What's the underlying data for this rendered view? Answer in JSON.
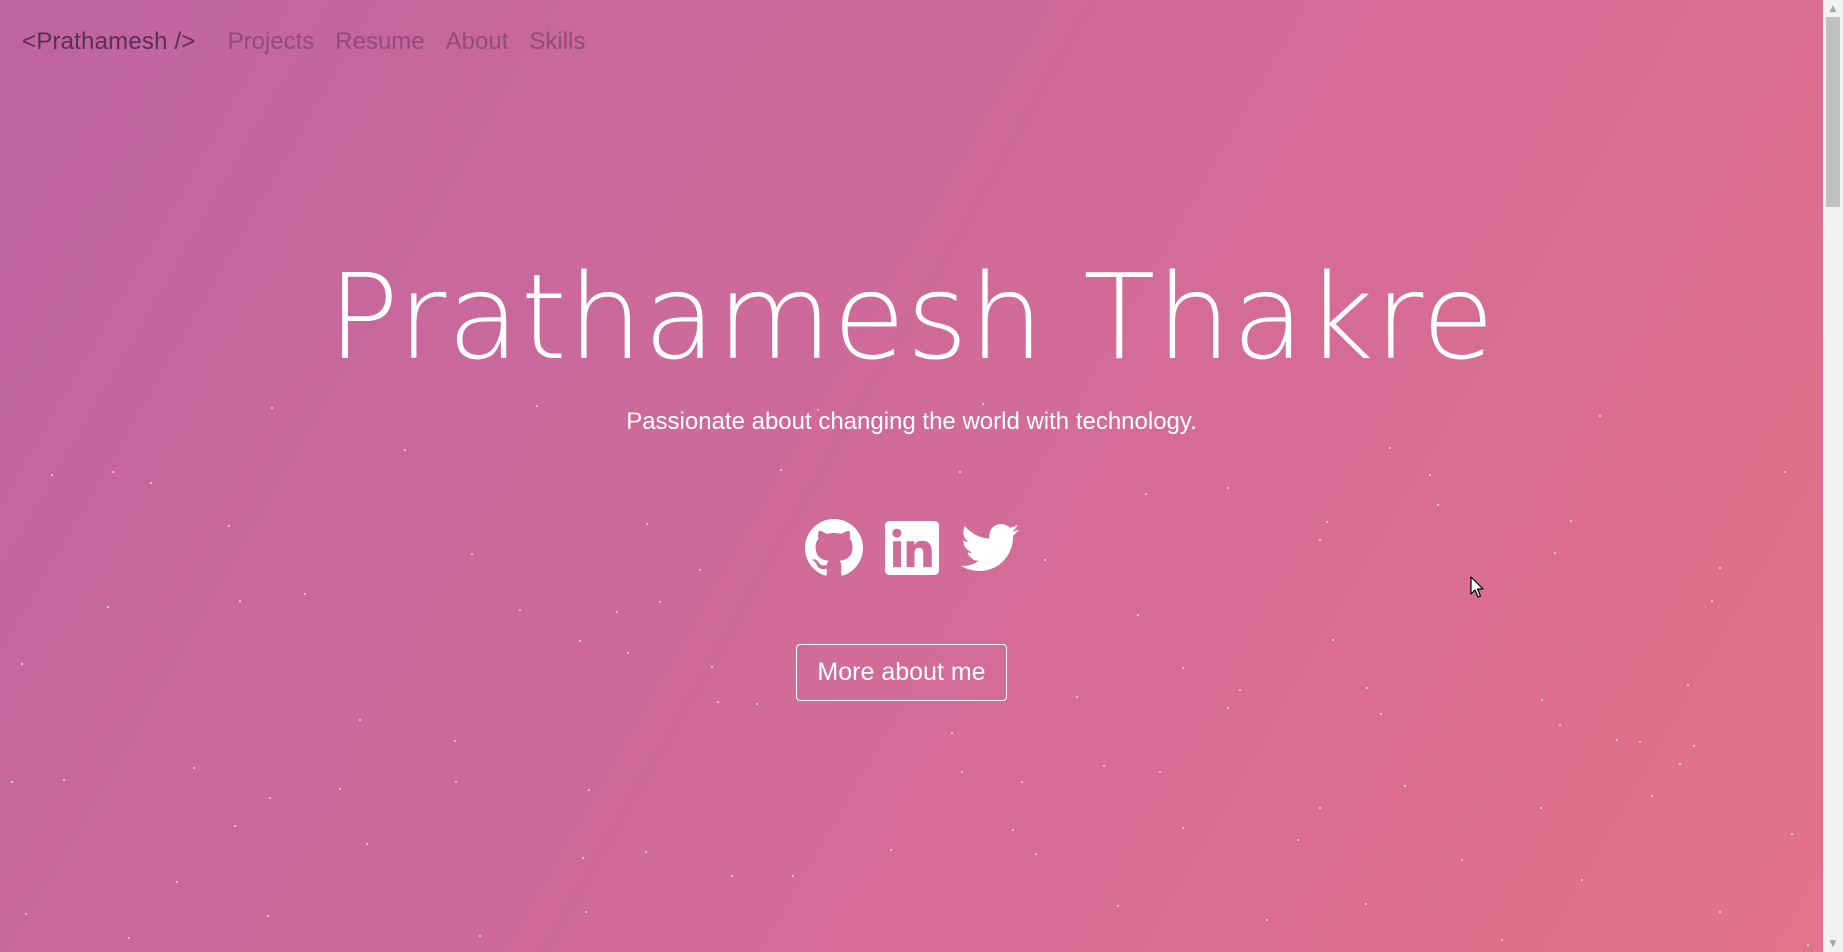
{
  "navbar": {
    "brand": "<Prathamesh />",
    "links": [
      "Projects",
      "Resume",
      "About",
      "Skills"
    ]
  },
  "hero": {
    "name": "Prathamesh Thakre",
    "tagline": "Passionate about changing the world with technology.",
    "socials": [
      {
        "icon": "github-icon"
      },
      {
        "icon": "linkedin-icon"
      },
      {
        "icon": "twitter-icon"
      }
    ],
    "cta_label": "More about me"
  },
  "colors": {
    "gradient_start": "#bf64a1",
    "gradient_end": "#e3738a",
    "text": "#ffffff",
    "brand_text": "#5a2f50",
    "nav_text": "#8a4677"
  }
}
